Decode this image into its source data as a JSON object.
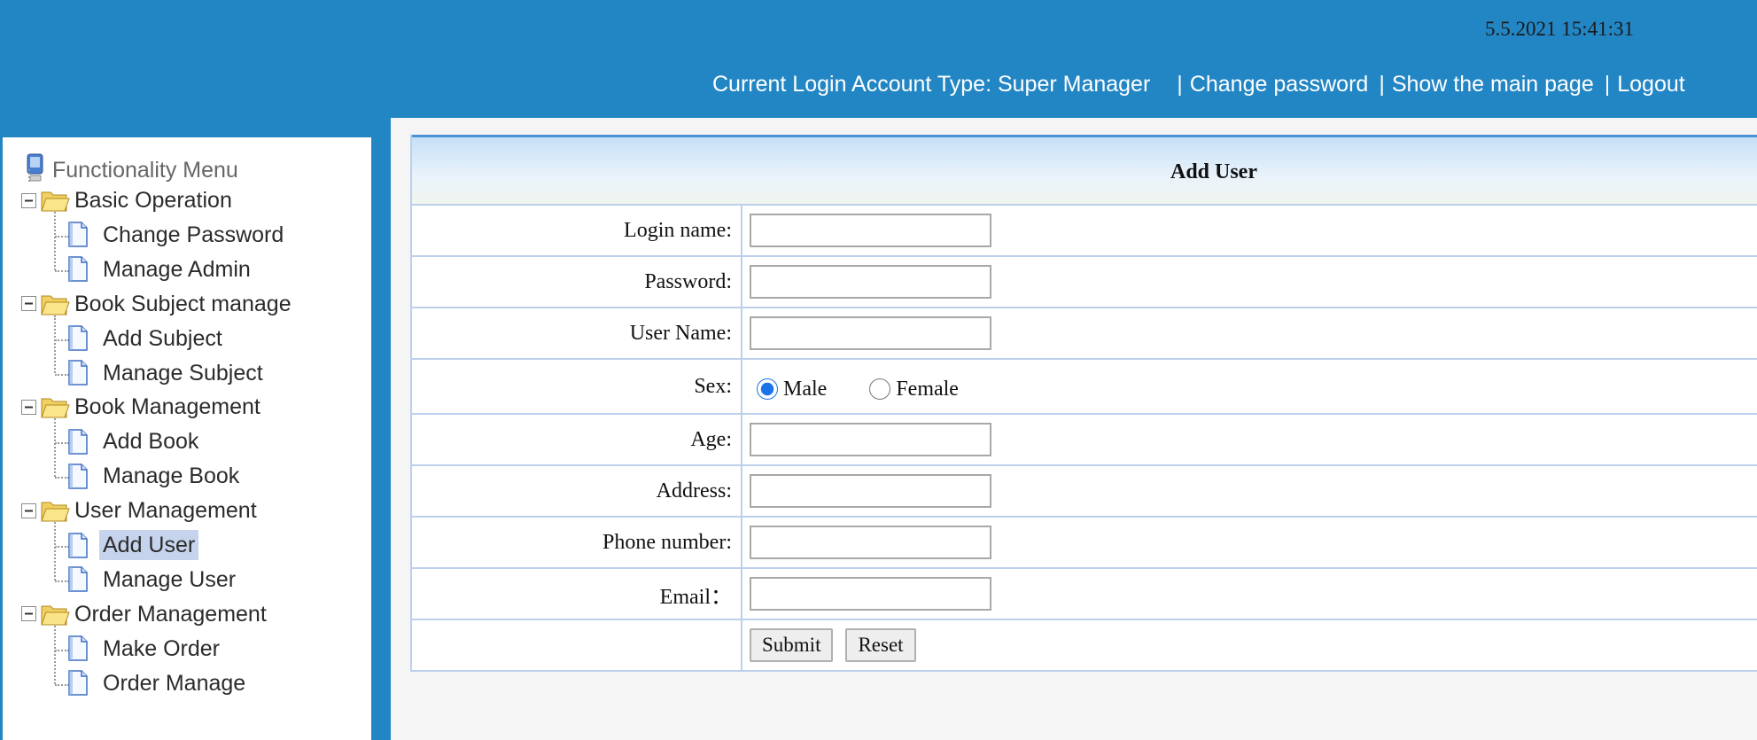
{
  "header": {
    "datetime": "5.5.2021 15:41:31",
    "account_type": "Current Login Account Type: Super Manager",
    "nav": [
      {
        "label": "Change password"
      },
      {
        "label": "Show the main page"
      },
      {
        "label": "Logout"
      }
    ],
    "separator": "|"
  },
  "sidebar": {
    "title": "Functionality Menu",
    "groups": [
      {
        "label": "Basic Operation",
        "items": [
          {
            "label": "Change Password"
          },
          {
            "label": "Manage Admin"
          }
        ]
      },
      {
        "label": "Book Subject manage",
        "items": [
          {
            "label": "Add Subject"
          },
          {
            "label": "Manage Subject"
          }
        ]
      },
      {
        "label": "Book Management",
        "items": [
          {
            "label": "Add Book"
          },
          {
            "label": "Manage Book"
          }
        ]
      },
      {
        "label": "User Management",
        "items": [
          {
            "label": "Add User"
          },
          {
            "label": "Manage User"
          }
        ]
      },
      {
        "label": "Order Management",
        "items": [
          {
            "label": "Make Order"
          },
          {
            "label": "Order Manage"
          }
        ]
      }
    ],
    "selected": "Add User"
  },
  "form": {
    "title": "Add User",
    "fields": {
      "login_name": {
        "label": "Login name:",
        "value": ""
      },
      "password": {
        "label": "Password:",
        "value": ""
      },
      "user_name": {
        "label": "User Name:",
        "value": ""
      },
      "sex": {
        "label": "Sex:",
        "options": [
          "Male",
          "Female"
        ],
        "selected": "Male"
      },
      "age": {
        "label": "Age:",
        "value": ""
      },
      "address": {
        "label": "Address:",
        "value": ""
      },
      "phone": {
        "label": "Phone number:",
        "value": ""
      },
      "email": {
        "label": "Email：",
        "value": ""
      }
    },
    "submit_label": "Submit",
    "reset_label": "Reset"
  },
  "colors": {
    "header_bg": "#2386c4",
    "selected_bg": "#c5d4ec",
    "table_border": "#bcd0ec",
    "panel_top_border": "#4b91d6"
  },
  "icons": [
    "computer-icon",
    "minus-box-icon",
    "folder-open-icon",
    "document-icon"
  ]
}
